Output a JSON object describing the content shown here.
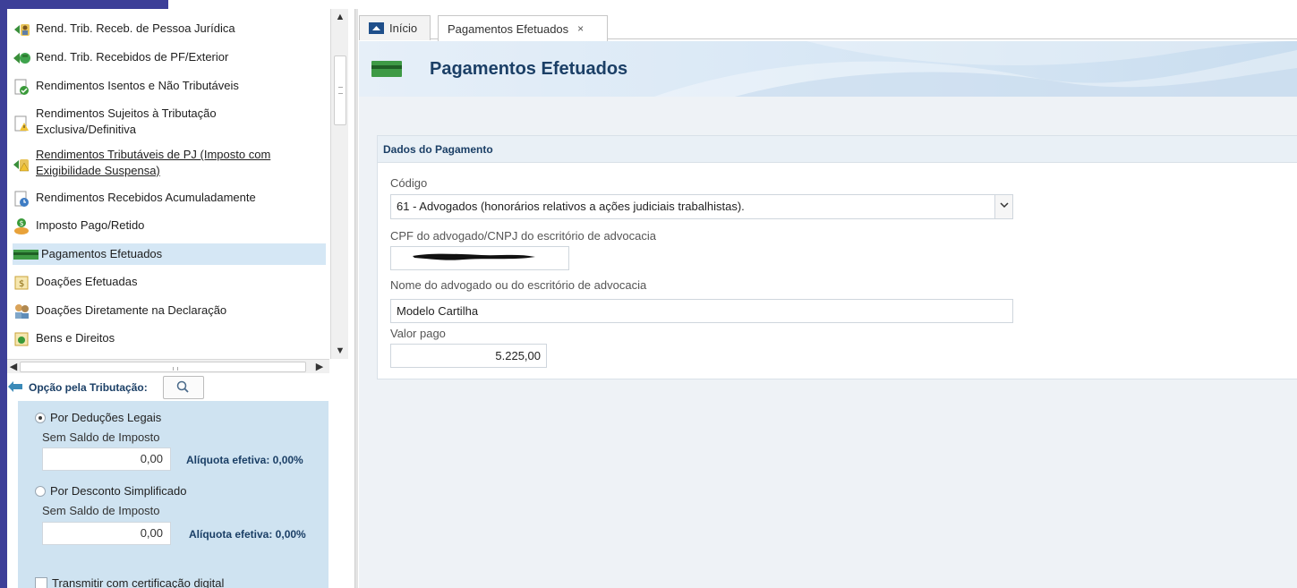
{
  "nav": {
    "items": [
      {
        "label": "Rend. Trib. Receb. de Pessoa Jurídica"
      },
      {
        "label": "Rend. Trib. Recebidos de PF/Exterior"
      },
      {
        "label": "Rendimentos Isentos e Não Tributáveis"
      },
      {
        "label_line1": "Rendimentos Sujeitos à Tributação",
        "label_line2": "Exclusiva/Definitiva"
      },
      {
        "label_line1": "Rendimentos Tributáveis de PJ (Imposto com",
        "label_line2": "Exigibilidade Suspensa)"
      },
      {
        "label": "Rendimentos Recebidos Acumuladamente"
      },
      {
        "label": "Imposto Pago/Retido"
      },
      {
        "label": "Pagamentos Efetuados"
      },
      {
        "label": "Doações Efetuadas"
      },
      {
        "label": "Doações Diretamente na Declaração"
      },
      {
        "label": "Bens e Direitos"
      }
    ]
  },
  "opcao": {
    "title": "Opção pela Tributação:",
    "deducoes": {
      "label": "Por Deduções Legais",
      "saldo_label": "Sem Saldo de Imposto",
      "value": "0,00",
      "aliquota": "Alíquota efetiva: 0,00%"
    },
    "simplificado": {
      "label": "Por Desconto Simplificado",
      "saldo_label": "Sem Saldo de Imposto",
      "value": "0,00",
      "aliquota": "Alíquota efetiva: 0,00%"
    },
    "certificacao_label": "Transmitir com certificação digital"
  },
  "tabs": [
    {
      "label": "Início"
    },
    {
      "label": "Pagamentos Efetuados",
      "close": "×"
    }
  ],
  "page": {
    "title": "Pagamentos Efetuados"
  },
  "form": {
    "section_title": "Dados do Pagamento",
    "codigo_label": "Código",
    "codigo_value": "61 - Advogados (honorários relativos a ações judiciais trabalhistas).",
    "cpf_label": "CPF do advogado/CNPJ do escritório de advocacia",
    "nome_label": "Nome do advogado ou do escritório de advocacia",
    "nome_value": "Modelo Cartilha",
    "valor_label": "Valor pago",
    "valor_value": "5.225,00"
  },
  "colors": {
    "accent": "#1b3f66",
    "stripe": "#3d3f98",
    "selected": "#d5e7f5",
    "panel": "#cfe3f1"
  }
}
